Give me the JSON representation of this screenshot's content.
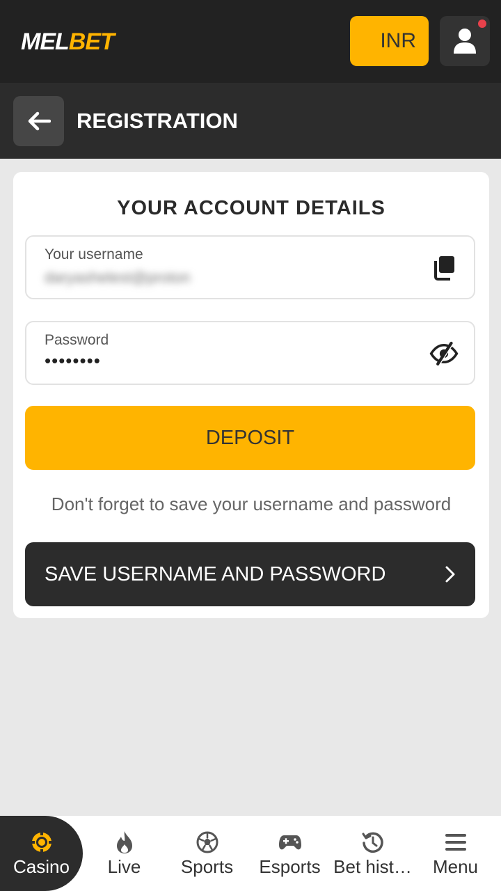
{
  "header": {
    "logo_part1": "MEL",
    "logo_part2": "BET",
    "currency": "INR",
    "icons": {
      "user": "user-icon",
      "notification": "notification-dot"
    }
  },
  "subheader": {
    "back_icon": "arrow-left-icon",
    "title": "REGISTRATION"
  },
  "card": {
    "title": "YOUR ACCOUNT DETAILS",
    "username_field": {
      "label": "Your username",
      "value": "daryashelest@proton",
      "icon": "copy-icon"
    },
    "password_field": {
      "label": "Password",
      "value": "••••••••",
      "icon": "eye-off-icon"
    },
    "deposit_label": "DEPOSIT",
    "hint": "Don't forget to save your username and password",
    "save_label": "SAVE USERNAME AND PASSWORD",
    "save_icon": "chevron-right-icon"
  },
  "bottom_nav": {
    "items": [
      {
        "label": "Casino",
        "icon": "casino-chip-icon",
        "active": true
      },
      {
        "label": "Live",
        "icon": "flame-icon",
        "active": false
      },
      {
        "label": "Sports",
        "icon": "soccer-ball-icon",
        "active": false
      },
      {
        "label": "Esports",
        "icon": "gamepad-icon",
        "active": false
      },
      {
        "label": "Bet hist…",
        "icon": "history-icon",
        "active": false
      },
      {
        "label": "Menu",
        "icon": "menu-icon",
        "active": false
      }
    ]
  },
  "colors": {
    "accent": "#ffb400",
    "header_bg": "#222222",
    "subheader_bg": "#2c2c2c",
    "page_bg": "#e8e8e8",
    "notification": "#e8414b"
  }
}
